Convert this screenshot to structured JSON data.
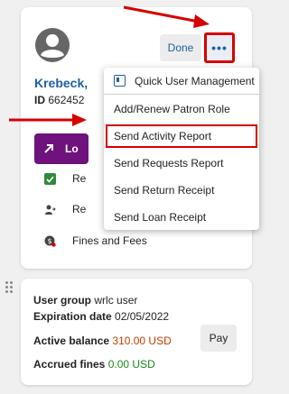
{
  "header": {
    "done_label": "Done",
    "more_label": "•••"
  },
  "patron": {
    "name": "Krebeck,",
    "id_label": "ID",
    "id_value": "662452"
  },
  "loan_button": {
    "label": "Lo"
  },
  "side_items": [
    {
      "label": "Re",
      "icon": "checkbox-icon"
    },
    {
      "label": "Re",
      "icon": "user-swap-icon"
    },
    {
      "label": "Fines and Fees",
      "icon": "money-icon"
    }
  ],
  "menu": {
    "items": [
      {
        "label": "Quick User Management"
      },
      {
        "label": "Add/Renew Patron Role"
      },
      {
        "label": "Send Activity Report"
      },
      {
        "label": "Send Requests Report"
      },
      {
        "label": "Send Return Receipt"
      },
      {
        "label": "Send Loan Receipt"
      }
    ]
  },
  "account": {
    "user_group_label": "User group",
    "user_group_value": "wrlc user",
    "expiration_label": "Expiration date",
    "expiration_value": "02/05/2022",
    "active_balance_label": "Active balance",
    "active_balance_value": "310.00 USD",
    "accrued_fines_label": "Accrued fines",
    "accrued_fines_value": "0.00 USD",
    "pay_label": "Pay"
  },
  "colors": {
    "accent": "#1d5fa6",
    "loan_button": "#6e127c",
    "annotation": "#d60000",
    "balance": "#c23b00",
    "fines": "#1a8a1a"
  }
}
